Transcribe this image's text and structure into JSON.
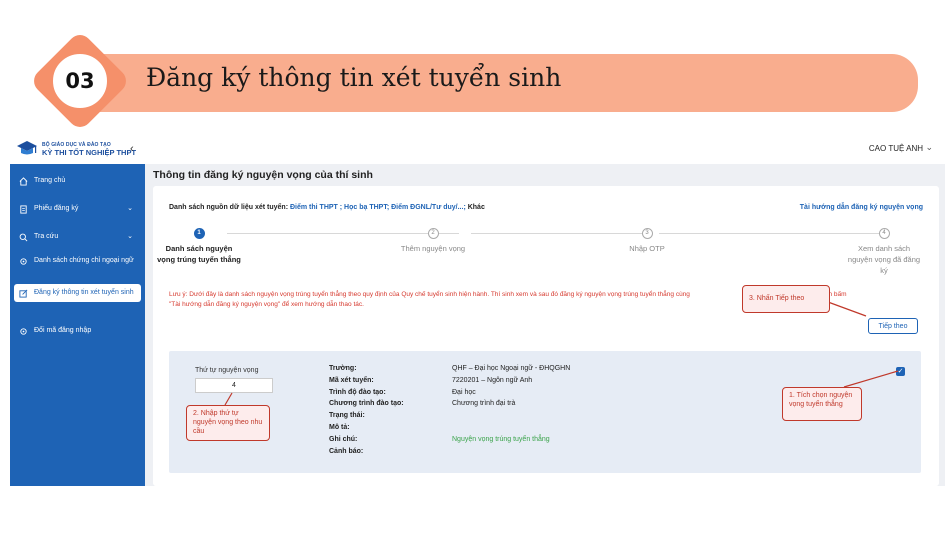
{
  "slide": {
    "number": "03",
    "title": "Đăng ký thông tin xét tuyển sinh"
  },
  "topbar": {
    "logo_sub": "BỘ GIÁO DỤC VÀ ĐÀO TẠO",
    "logo_main": "KỲ THI TỐT NGHIỆP THPT",
    "collapse": "‹",
    "user_name": "CAO TUỆ ANH",
    "user_chevron": "⌄"
  },
  "sidebar": {
    "items": [
      {
        "label": "Trang chủ",
        "icon": "home-icon"
      },
      {
        "label": "Phiếu đăng ký",
        "icon": "document-icon",
        "chevron": "⌄"
      },
      {
        "label": "Tra cứu",
        "icon": "search-icon",
        "chevron": "⌄"
      },
      {
        "label": "Danh sách chứng chỉ ngoại ngữ",
        "icon": "gear-icon"
      },
      {
        "label": "Đăng ký thông tin xét tuyển sinh",
        "icon": "edit-icon",
        "active": true
      },
      {
        "label": "Đổi mã đăng nhập",
        "icon": "gear-icon"
      }
    ]
  },
  "main": {
    "title": "Thông tin đăng ký nguyện vọng của thí sinh",
    "source_label": "Danh sách nguồn dữ liệu xét tuyển:",
    "source_values": "Điểm thi THPT ; Học bạ THPT; Điểm ĐGNL/Tư duy/...;",
    "source_other": " Khác",
    "guide_link": "Tài hướng dẫn đăng ký nguyện vọng",
    "steps": [
      {
        "num": "1",
        "label": "Danh sách nguyện vọng trúng tuyển thẳng"
      },
      {
        "num": "2",
        "label": "Thêm nguyện vọng"
      },
      {
        "num": "3",
        "label": "Nhập OTP"
      },
      {
        "num": "4",
        "label": "Xem danh sách nguyện vọng đã đăng ký"
      }
    ],
    "note_line1": "Lưu ý: Dưới đây là danh sách nguyện vọng trúng tuyển thẳng theo quy định của Quy chế tuyển sinh hiện hành. Thí sinh xem và sau đó đăng ký nguyện vọng trúng tuyển thẳng cùng",
    "note_line1_tail": "theo lịch chung. Thí sinh bấm",
    "note_line2": "\"Tài hướng dẫn đăng ký nguyện vọng\" để xem hướng dẫn thao tác.",
    "next_button": "Tiếp theo",
    "panel": {
      "order_label": "Thứ tự nguyện vọng",
      "order_value": "4",
      "fields": [
        {
          "key": "Trường:",
          "value": "QHF – Đại học Ngoại ngữ - ĐHQGHN"
        },
        {
          "key": "Mã xét tuyển:",
          "value": "7220201 – Ngôn ngữ Anh"
        },
        {
          "key": "Trình độ đào tạo:",
          "value": "Đại học"
        },
        {
          "key": "Chương trình đào tạo:",
          "value": "Chương trình đại trà"
        },
        {
          "key": "Trạng thái:",
          "value": ""
        },
        {
          "key": "Mô tả:",
          "value": ""
        },
        {
          "key": "Ghi chú:",
          "value": "Nguyện vọng trúng tuyển thẳng"
        },
        {
          "key": "Cảnh báo:",
          "value": ""
        }
      ],
      "checked": true
    }
  },
  "callouts": {
    "c1": "1. Tích chọn nguyện vọng tuyển thẳng",
    "c2": "2. Nhập thứ tự nguyện vọng theo nhu cầu",
    "c3": "3. Nhấn Tiếp theo"
  },
  "colors": {
    "accent": "#1e63b5",
    "banner": "#f9ad8e",
    "badge": "#f5906a",
    "note": "#d63a2f",
    "success": "#3aa34a"
  }
}
